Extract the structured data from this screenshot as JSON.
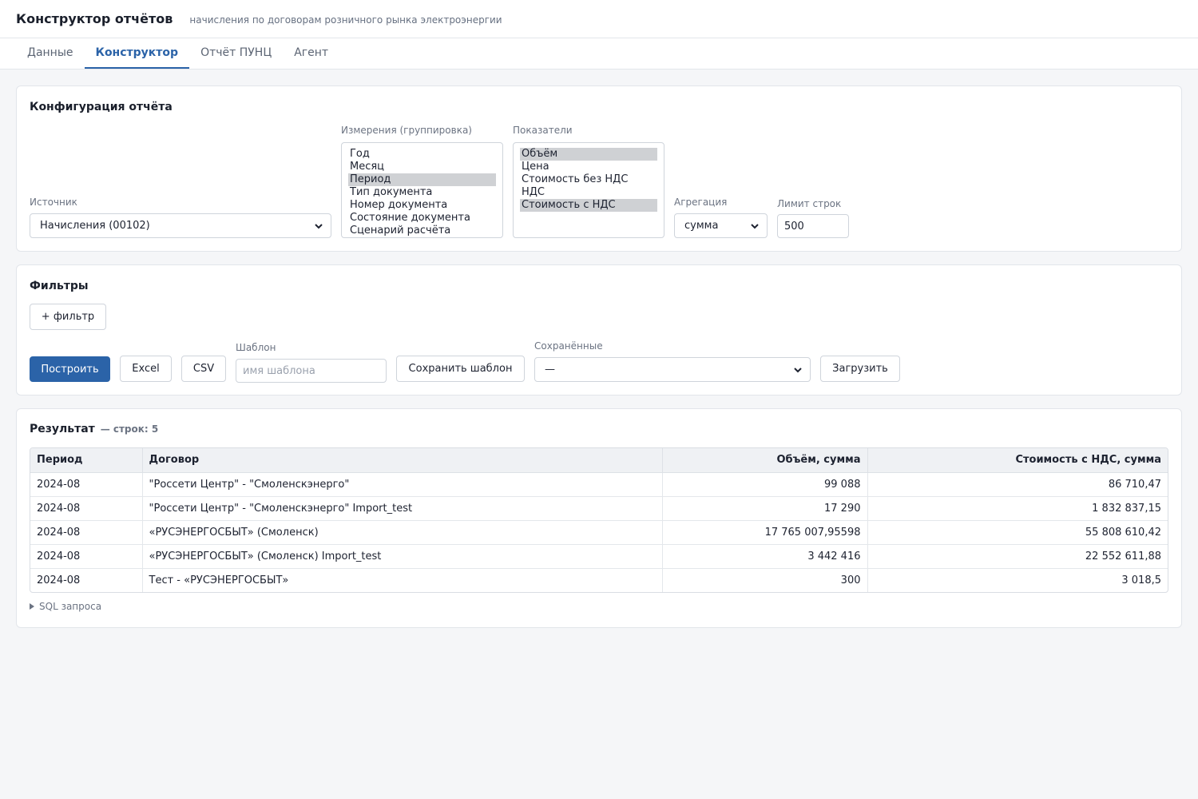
{
  "header": {
    "title": "Конструктор отчётов",
    "subtitle": "начисления по договорам розничного рынка электроэнергии"
  },
  "tabs": [
    {
      "label": "Данные",
      "active": false
    },
    {
      "label": "Конструктор",
      "active": true
    },
    {
      "label": "Отчёт ПУНЦ",
      "active": false
    },
    {
      "label": "Агент",
      "active": false
    }
  ],
  "config": {
    "title": "Конфигурация отчёта",
    "source_label": "Источник",
    "source_value": "Начисления (00102)",
    "dimensions_label": "Измерения (группировка)",
    "dimensions": [
      {
        "label": "Год",
        "selected": false
      },
      {
        "label": "Месяц",
        "selected": false
      },
      {
        "label": "Период",
        "selected": true
      },
      {
        "label": "Тип документа",
        "selected": false
      },
      {
        "label": "Номер документа",
        "selected": false
      },
      {
        "label": "Состояние документа",
        "selected": false
      },
      {
        "label": "Сценарий расчёта",
        "selected": false
      }
    ],
    "metrics_label": "Показатели",
    "metrics": [
      {
        "label": "Объём",
        "selected": true
      },
      {
        "label": "Цена",
        "selected": false
      },
      {
        "label": "Стоимость без НДС",
        "selected": false
      },
      {
        "label": "НДС",
        "selected": false
      },
      {
        "label": "Стоимость с НДС",
        "selected": true
      }
    ],
    "aggregation_label": "Агрегация",
    "aggregation_value": "сумма",
    "limit_label": "Лимит строк",
    "limit_value": "500"
  },
  "filters": {
    "title": "Фильтры",
    "add_filter_label": "+ фильтр",
    "build_label": "Построить",
    "excel_label": "Excel",
    "csv_label": "CSV",
    "template_label": "Шаблон",
    "template_placeholder": "имя шаблона",
    "save_template_label": "Сохранить шаблон",
    "saved_label": "Сохранённые",
    "saved_value": "—",
    "load_label": "Загрузить"
  },
  "result": {
    "title": "Результат",
    "count_text": "— строк: 5",
    "columns": [
      "Период",
      "Договор",
      "Объём, сумма",
      "Стоимость с НДС, сумма"
    ],
    "rows": [
      [
        "2024-08",
        "\"Россети Центр\" - \"Смоленскэнерго\"",
        "99 088",
        "86 710,47"
      ],
      [
        "2024-08",
        "\"Россети Центр\" - \"Смоленскэнерго\" Import_test",
        "17 290",
        "1 832 837,15"
      ],
      [
        "2024-08",
        "«РУСЭНЕРГОСБЫТ» (Смоленск)",
        "17 765 007,95598",
        "55 808 610,42"
      ],
      [
        "2024-08",
        "«РУСЭНЕРГОСБЫТ» (Смоленск) Import_test",
        "3 442 416",
        "22 552 611,88"
      ],
      [
        "2024-08",
        "Тест - «РУСЭНЕРГОСБЫТ»",
        "300",
        "3 018,5"
      ]
    ],
    "sql_toggle_label": "SQL запроса"
  }
}
